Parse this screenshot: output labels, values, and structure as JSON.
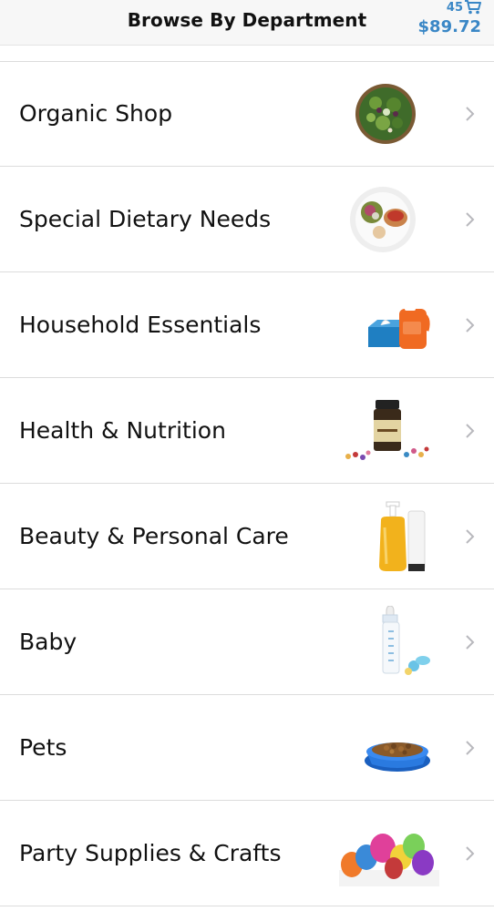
{
  "header": {
    "title": "Browse By Department",
    "cart_count": "45",
    "cart_total": "$89.72",
    "accent_color": "#3a87c6"
  },
  "departments": [
    {
      "label": "Organic Shop",
      "icon": "salad-bowl-icon"
    },
    {
      "label": "Special Dietary Needs",
      "icon": "meal-plate-icon"
    },
    {
      "label": "Household Essentials",
      "icon": "detergent-tissue-icon"
    },
    {
      "label": "Health & Nutrition",
      "icon": "vitamin-bottle-icon"
    },
    {
      "label": "Beauty & Personal Care",
      "icon": "soap-pump-icon"
    },
    {
      "label": "Baby",
      "icon": "baby-bottle-icon"
    },
    {
      "label": "Pets",
      "icon": "pet-bowl-icon"
    },
    {
      "label": "Party Supplies & Crafts",
      "icon": "balloons-icon"
    }
  ]
}
